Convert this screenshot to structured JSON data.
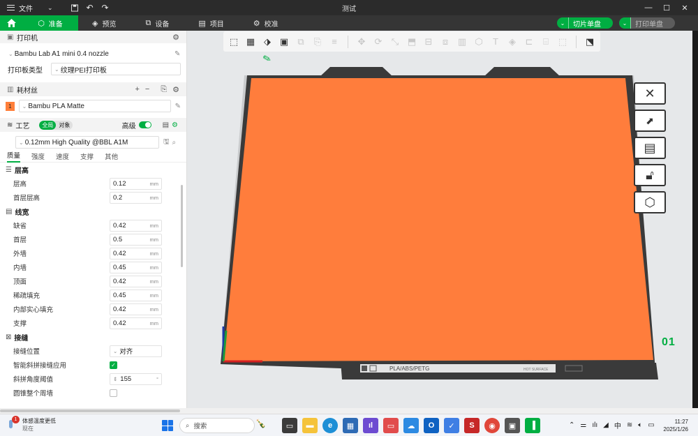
{
  "titlebar": {
    "file_label": "文件",
    "window_title": "测试",
    "icons": [
      "menu-icon",
      "chevron-down-icon",
      "save-icon",
      "undo-icon",
      "redo-icon"
    ],
    "window_controls": [
      "minimize-icon",
      "maximize-icon",
      "close-icon"
    ]
  },
  "tabs": {
    "prepare": "准备",
    "preview": "预览",
    "device": "设备",
    "project": "项目",
    "calibration": "校准",
    "slice_button": "切片单盘",
    "print_button": "打印单盘"
  },
  "printer": {
    "section_title": "打印机",
    "name": "Bambu Lab A1 mini 0.4 nozzle",
    "plate_type_label": "打印板类型",
    "plate_type_value": "纹理PEI打印板"
  },
  "filament": {
    "section_title": "耗材丝",
    "slot_number": "1",
    "slot_color": "#ff7f3a",
    "name": "Bambu PLA Matte"
  },
  "process": {
    "section_title": "工艺",
    "toggle_global": "全局",
    "toggle_object": "对象",
    "advanced_label": "高级",
    "preset": "0.12mm High Quality @BBL A1M",
    "subtabs": [
      "质量",
      "强度",
      "速度",
      "支撑",
      "其他"
    ]
  },
  "params": {
    "layer_height_group": "层高",
    "layer_height": {
      "label": "层高",
      "value": "0.12",
      "unit": "mm"
    },
    "first_layer_height": {
      "label": "首层层高",
      "value": "0.2",
      "unit": "mm"
    },
    "line_width_group": "线宽",
    "default_width": {
      "label": "缺省",
      "value": "0.42",
      "unit": "mm"
    },
    "first_layer_width": {
      "label": "首层",
      "value": "0.5",
      "unit": "mm"
    },
    "outer_wall": {
      "label": "外墙",
      "value": "0.42",
      "unit": "mm"
    },
    "inner_wall": {
      "label": "内墙",
      "value": "0.45",
      "unit": "mm"
    },
    "top_surface": {
      "label": "顶面",
      "value": "0.42",
      "unit": "mm"
    },
    "sparse_infill": {
      "label": "稀疏填充",
      "value": "0.45",
      "unit": "mm"
    },
    "internal_solid": {
      "label": "内部实心填充",
      "value": "0.42",
      "unit": "mm"
    },
    "support": {
      "label": "支撑",
      "value": "0.42",
      "unit": "mm"
    },
    "seam_group": "接缝",
    "seam_position": {
      "label": "接缝位置",
      "value": "对齐"
    },
    "scarf_seam": {
      "label": "智能斜拼接缝应用"
    },
    "scarf_angle": {
      "label": "斜拼角度阈值",
      "value": "155",
      "unit": "°"
    },
    "seam_partial": {
      "label": "圆锥整个周墙"
    }
  },
  "canvas": {
    "bed_label": "PLA/ABS/PETG",
    "surface_label": "HOT SURFACE",
    "plate_number": "01",
    "model_color": "#ff7d3c",
    "accent": "#00ae42"
  },
  "taskbar": {
    "weather_badge": "1",
    "weather_title": "体感温度更低",
    "weather_sub": "现在",
    "search_placeholder": "搜索",
    "ime": "中",
    "time": "11:27",
    "date": "2025/1/26"
  }
}
